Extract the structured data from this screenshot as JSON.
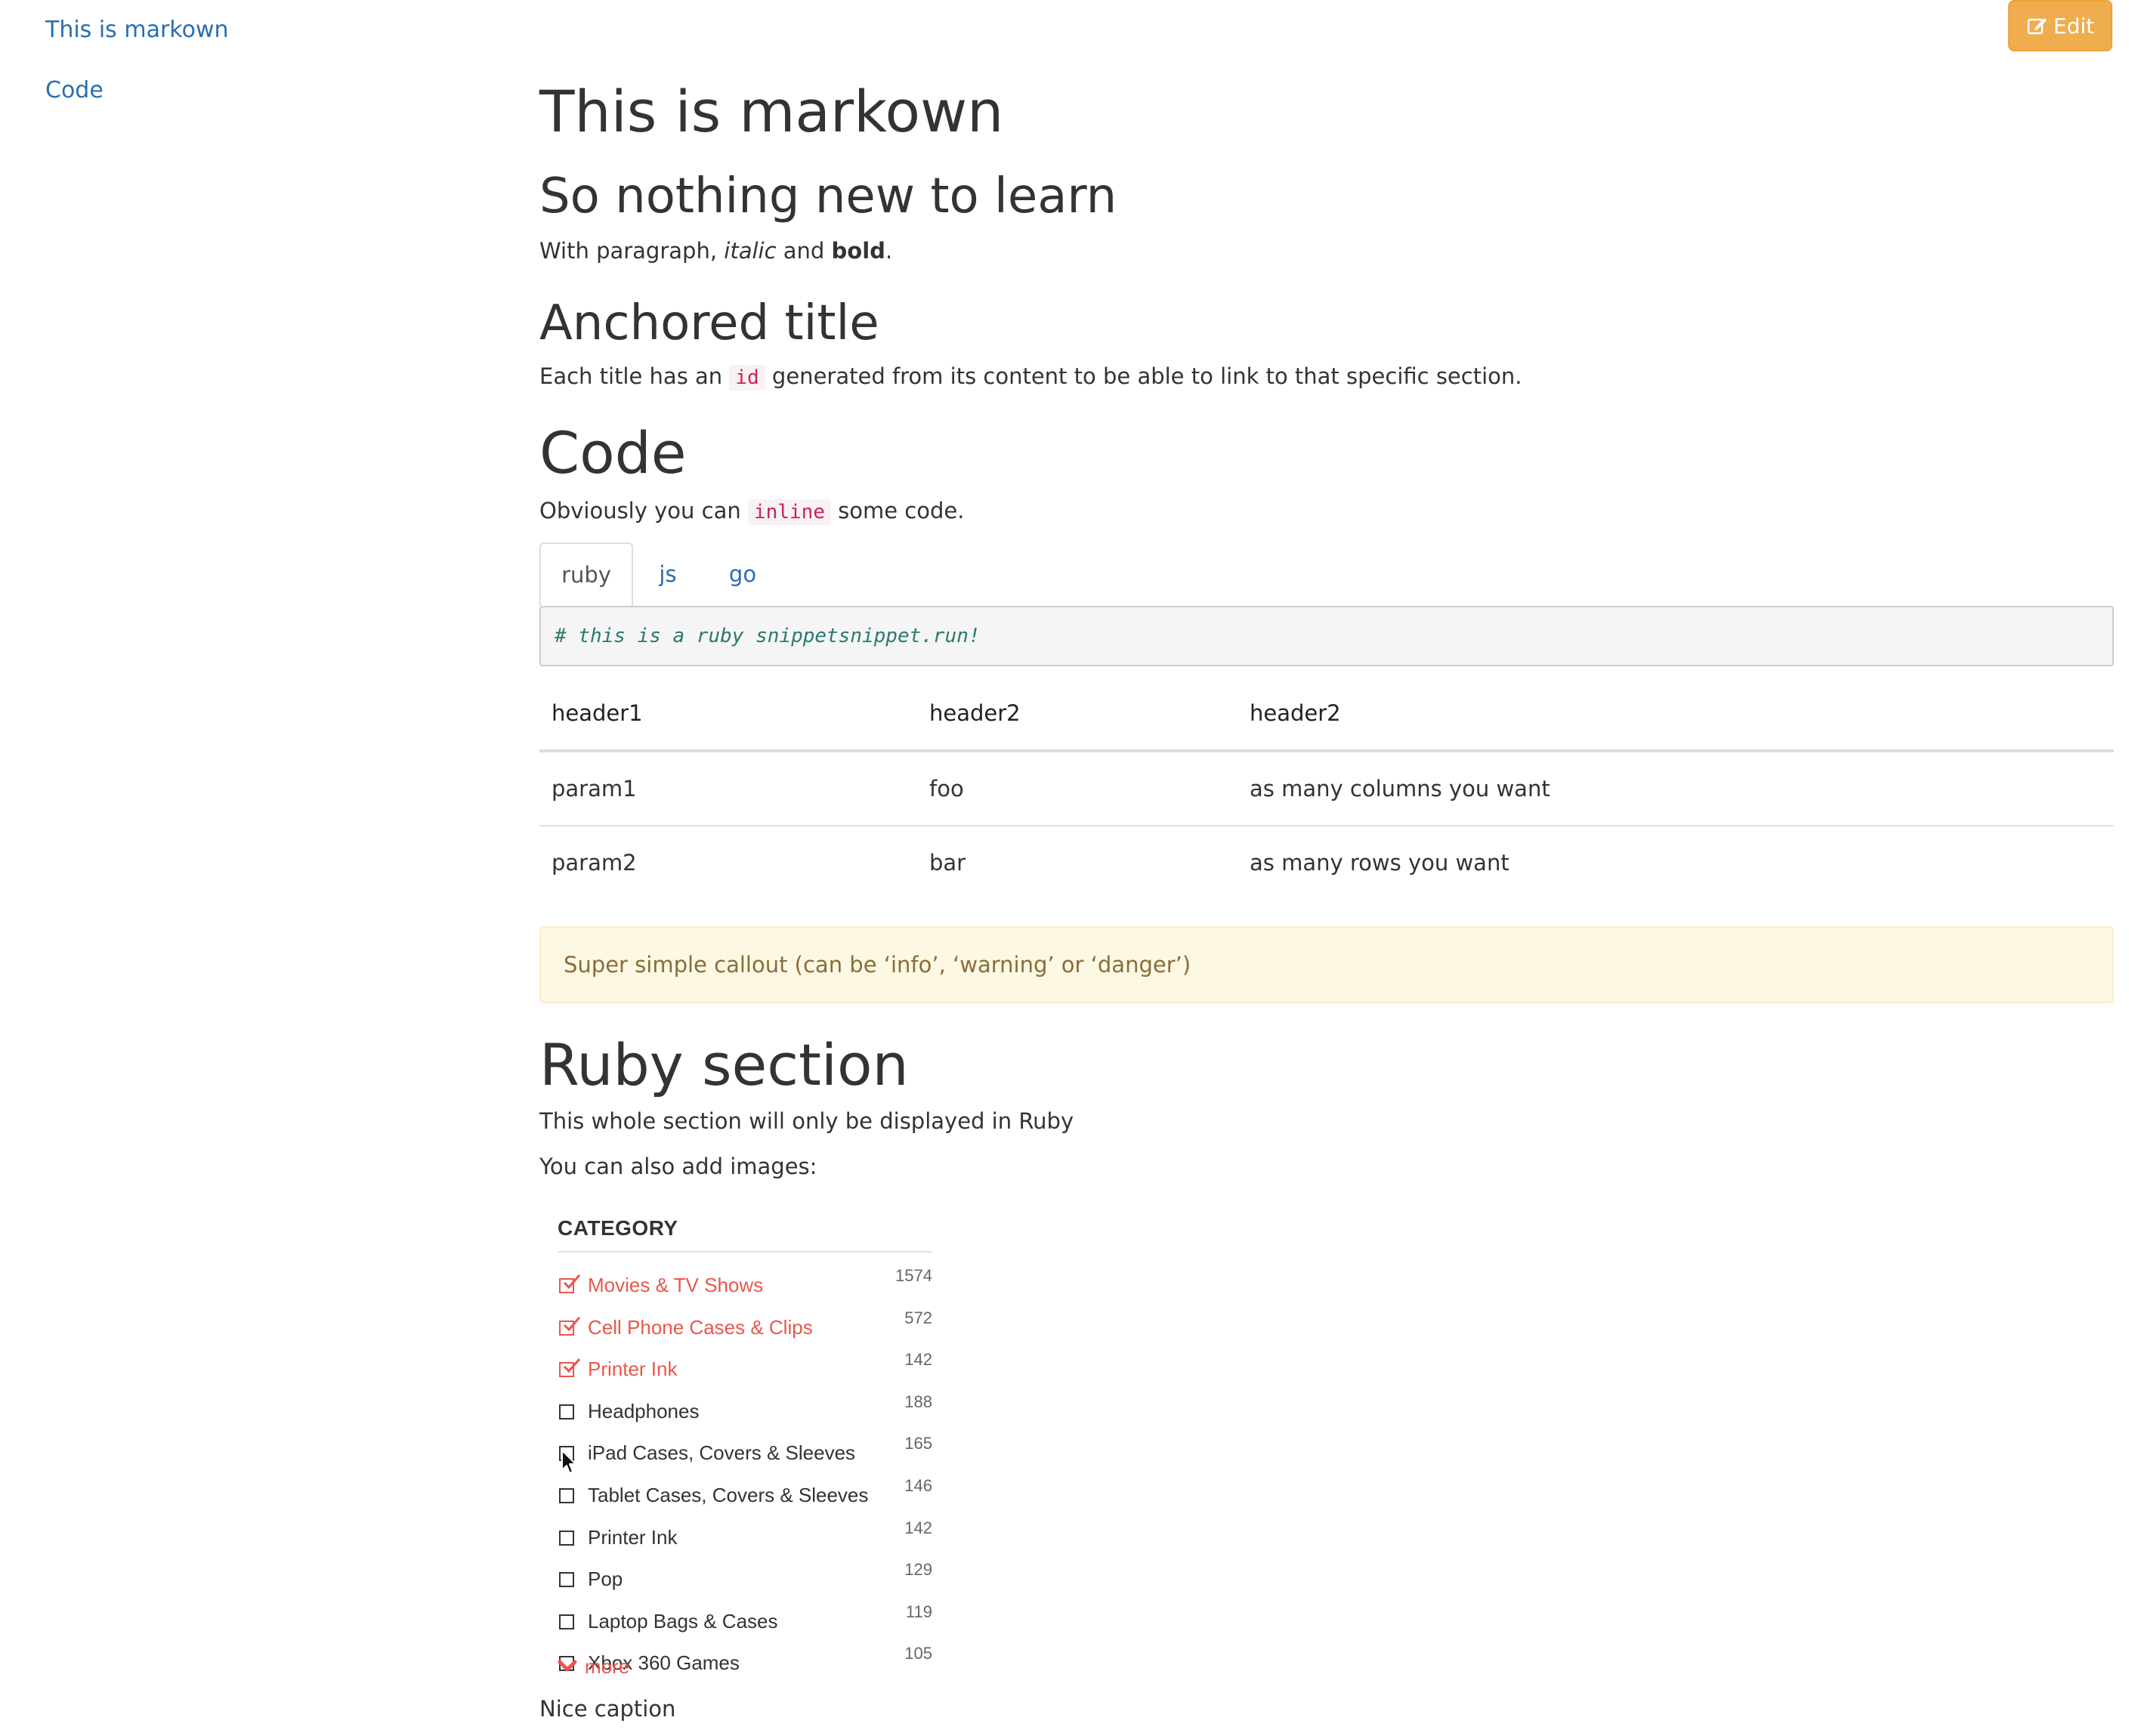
{
  "sidebar": {
    "items": [
      {
        "label": "This is markown"
      },
      {
        "label": "Code"
      }
    ]
  },
  "toolbar": {
    "edit_label": "Edit",
    "edit_icon": "pencil-square-icon",
    "edit_color": "#f0ad4e"
  },
  "content": {
    "title": "This is markown",
    "subtitle": "So nothing new to learn",
    "para1": {
      "before": "With paragraph, ",
      "italic": "italic",
      "middle": " and ",
      "bold": "bold",
      "after": "."
    },
    "anchored_title": "Anchored title",
    "para2": {
      "before": "Each title has an ",
      "code": "id",
      "after": " generated from its content to be able to link to that specific section."
    },
    "code_title": "Code",
    "para3": {
      "before": "Obviously you can ",
      "code": "inline",
      "after": " some code."
    },
    "tabs": [
      {
        "label": "ruby",
        "active": true
      },
      {
        "label": "js",
        "active": false
      },
      {
        "label": "go",
        "active": false
      }
    ],
    "code_snippet": "# this is a ruby snippetsnippet.run!",
    "table": {
      "headers": [
        "header1",
        "header2",
        "header2"
      ],
      "rows": [
        [
          "param1",
          "foo",
          "as many columns you want"
        ],
        [
          "param2",
          "bar",
          "as many rows you want"
        ]
      ]
    },
    "callout": "Super simple callout (can be ‘info’, ‘warning’ or ‘danger’)",
    "ruby_title": "Ruby section",
    "para4": "This whole section will only be displayed in Ruby",
    "para5": "You can also add images:",
    "caption": "Nice caption"
  },
  "category_image": {
    "title": "CATEGORY",
    "items": [
      {
        "label": "Movies & TV Shows",
        "count": "1574",
        "checked": true
      },
      {
        "label": "Cell Phone Cases & Clips",
        "count": "572",
        "checked": true
      },
      {
        "label": "Printer Ink",
        "count": "142",
        "checked": true
      },
      {
        "label": "Headphones",
        "count": "188",
        "checked": false
      },
      {
        "label": "iPad Cases, Covers & Sleeves",
        "count": "165",
        "checked": false
      },
      {
        "label": "Tablet Cases, Covers & Sleeves",
        "count": "146",
        "checked": false
      },
      {
        "label": "Printer Ink",
        "count": "142",
        "checked": false
      },
      {
        "label": "Pop",
        "count": "129",
        "checked": false
      },
      {
        "label": "Laptop Bags & Cases",
        "count": "119",
        "checked": false
      },
      {
        "label": "Xbox 360 Games",
        "count": "105",
        "checked": false
      }
    ],
    "more_label": "more",
    "accent_color": "#e8584c"
  },
  "colors": {
    "link": "#2a6fae",
    "callout_bg": "#fcf8e3",
    "callout_text": "#8a6d3b",
    "inline_code": "#c7254e"
  }
}
